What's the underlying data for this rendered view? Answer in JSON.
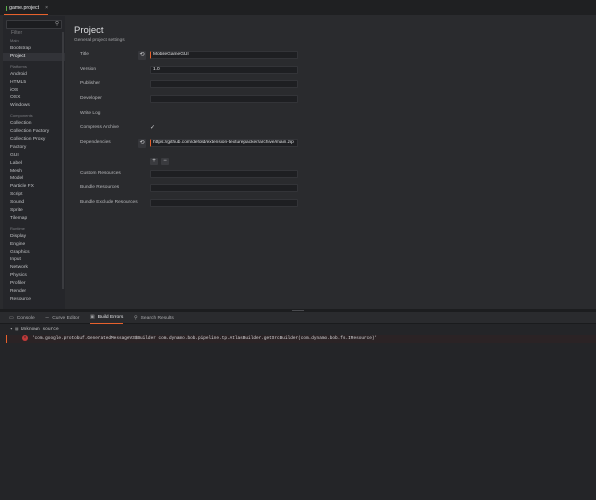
{
  "tab": {
    "title": "game.project",
    "close": "×"
  },
  "sidebar": {
    "filter_placeholder": "Filter",
    "groups": [
      {
        "label": "Main",
        "items": [
          "Bootstrap",
          "Project"
        ]
      },
      {
        "label": "Platforms",
        "items": [
          "Android",
          "HTML5",
          "iOS",
          "OSX",
          "Windows"
        ]
      },
      {
        "label": "Components",
        "items": [
          "Collection",
          "Collection Factory",
          "Collection Proxy",
          "Factory",
          "GUI",
          "Label",
          "Mesh",
          "Model",
          "Particle FX",
          "Script",
          "Sound",
          "Sprite",
          "Tilemap"
        ]
      },
      {
        "label": "Runtime",
        "items": [
          "Display",
          "Engine",
          "Graphics",
          "Input",
          "Network",
          "Physics",
          "Profiler",
          "Render",
          "Resource"
        ]
      }
    ],
    "active_item": "Project"
  },
  "page": {
    "title": "Project",
    "subtitle": "General project settings"
  },
  "fields": {
    "title": {
      "label": "Title",
      "value": "MobileGameGUI"
    },
    "version": {
      "label": "Version",
      "value": "1.0"
    },
    "publisher": {
      "label": "Publisher",
      "value": ""
    },
    "developer": {
      "label": "Developer",
      "value": ""
    },
    "write_log": {
      "label": "Write Log"
    },
    "compress_archive": {
      "label": "Compress Archive",
      "checked": true,
      "mark": "✓"
    },
    "dependencies": {
      "label": "Dependencies",
      "value": "https://github.com/defold/extension-texturepacker/archive/main.zip"
    },
    "custom_resources": {
      "label": "Custom Resources",
      "value": ""
    },
    "bundle_resources": {
      "label": "Bundle Resources",
      "value": ""
    },
    "bundle_exclude_resources": {
      "label": "Bundle Exclude Resources",
      "value": ""
    }
  },
  "buttons": {
    "reset_glyph": "⟲",
    "add": "+",
    "remove": "−"
  },
  "bottom_tabs": [
    {
      "label": "Console",
      "icon": "console-icon"
    },
    {
      "label": "Curve Editor",
      "icon": "curve-icon"
    },
    {
      "label": "Build Errors",
      "icon": "build-errors-icon",
      "active": true
    },
    {
      "label": "Search Results",
      "icon": "search-icon"
    }
  ],
  "build_errors": {
    "source": "Unknown source",
    "message": "'com.google.protobuf.GeneratedMessageV3$Builder com.dynamo.bob.pipeline.tp.AtlasBuilder.getSrcBuilder(com.dynamo.bob.fs.IResource)'"
  },
  "colors": {
    "accent": "#e8612c",
    "error": "#c03a3a",
    "status_ok": "#5bb24a"
  }
}
